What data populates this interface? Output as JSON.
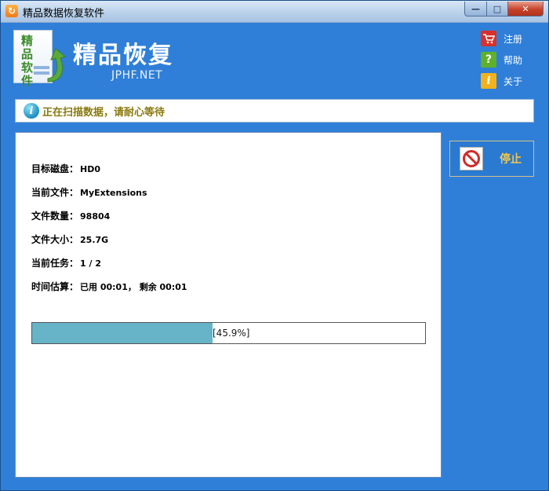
{
  "window": {
    "title": "精品数据恢复软件",
    "controls": {
      "minimize": "—",
      "maximize": "□",
      "close": "✕"
    }
  },
  "header": {
    "logo_text": "精品软件",
    "brand_title": "精品恢复",
    "brand_sub": "JPHF.NET",
    "links": [
      {
        "label": "注册",
        "icon": "cart-icon"
      },
      {
        "label": "帮助",
        "icon": "help-icon"
      },
      {
        "label": "关于",
        "icon": "info-icon"
      }
    ]
  },
  "status": {
    "icon_glyph": "i",
    "text": "正在扫描数据，请耐心等待"
  },
  "scan": {
    "rows": [
      {
        "label": "目标磁盘：",
        "value": "HD0"
      },
      {
        "label": "当前文件：",
        "value": "MyExtensions"
      },
      {
        "label": "文件数量：",
        "value": "98804"
      },
      {
        "label": "文件大小：",
        "value": "25.7G"
      },
      {
        "label": "当前任务：",
        "value": "1 / 2"
      },
      {
        "label": "时间估算：",
        "value": "已用 00:01， 剩余 00:01"
      }
    ],
    "progress": {
      "percent": 45.9,
      "label": "[45.9%]"
    }
  },
  "actions": {
    "stop_label": "停止"
  },
  "colors": {
    "window_bg": "#2f7fd8",
    "progress_fill": "#67b4c8",
    "status_text": "#8a7a10",
    "stop_label": "#f2c84b"
  }
}
